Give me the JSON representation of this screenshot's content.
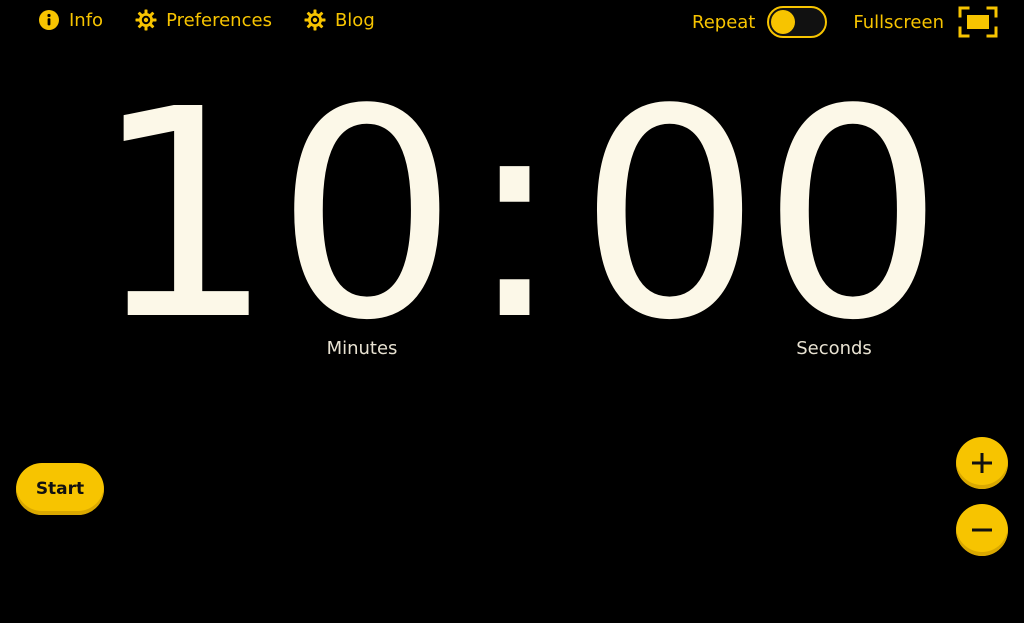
{
  "nav": {
    "items": [
      {
        "label": "Info",
        "icon": "info-icon"
      },
      {
        "label": "Preferences",
        "icon": "gear-icon"
      },
      {
        "label": "Blog",
        "icon": "gear-icon"
      }
    ],
    "repeat_label": "Repeat",
    "repeat_enabled": false,
    "fullscreen_label": "Fullscreen"
  },
  "timer": {
    "minutes": "10",
    "separator": ":",
    "seconds": "00",
    "minutes_label": "Minutes",
    "seconds_label": "Seconds"
  },
  "controls": {
    "start_label": "Start",
    "increase_icon": "plus-icon",
    "decrease_icon": "minus-icon"
  },
  "colors": {
    "accent": "#f7c400",
    "background": "#000000",
    "digits": "#fcf8e8"
  }
}
